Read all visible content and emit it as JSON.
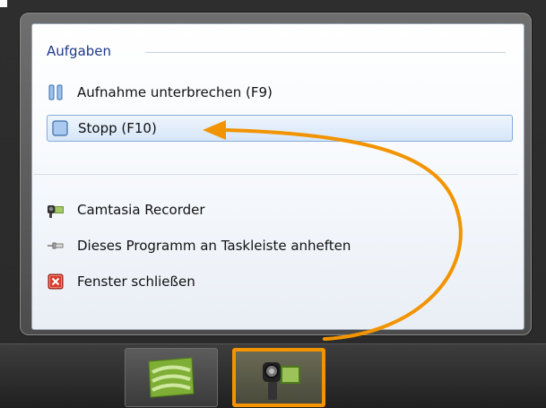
{
  "jumplist": {
    "section_title": "Aufgaben",
    "tasks": [
      {
        "label": "Aufnahme unterbrechen (F9)",
        "icon": "pause-icon"
      },
      {
        "label": "Stopp (F10)",
        "icon": "stop-icon",
        "selected": true
      }
    ],
    "app_items": [
      {
        "label": "Camtasia Recorder",
        "icon": "camtasia-recorder-icon"
      },
      {
        "label": "Dieses Programm an Taskleiste anheften",
        "icon": "pin-icon"
      },
      {
        "label": "Fenster schließen",
        "icon": "close-window-icon"
      }
    ]
  },
  "taskbar": {
    "buttons": [
      {
        "name": "camtasia-studio",
        "icon": "camtasia-studio-icon",
        "active": false
      },
      {
        "name": "camtasia-recorder",
        "icon": "camtasia-recorder-icon",
        "active": true
      }
    ]
  },
  "colors": {
    "accent_orange": "#f29400",
    "selection_border": "#84acdd",
    "section_title": "#1e3a8a",
    "taskbar": "#2a2a2a"
  }
}
